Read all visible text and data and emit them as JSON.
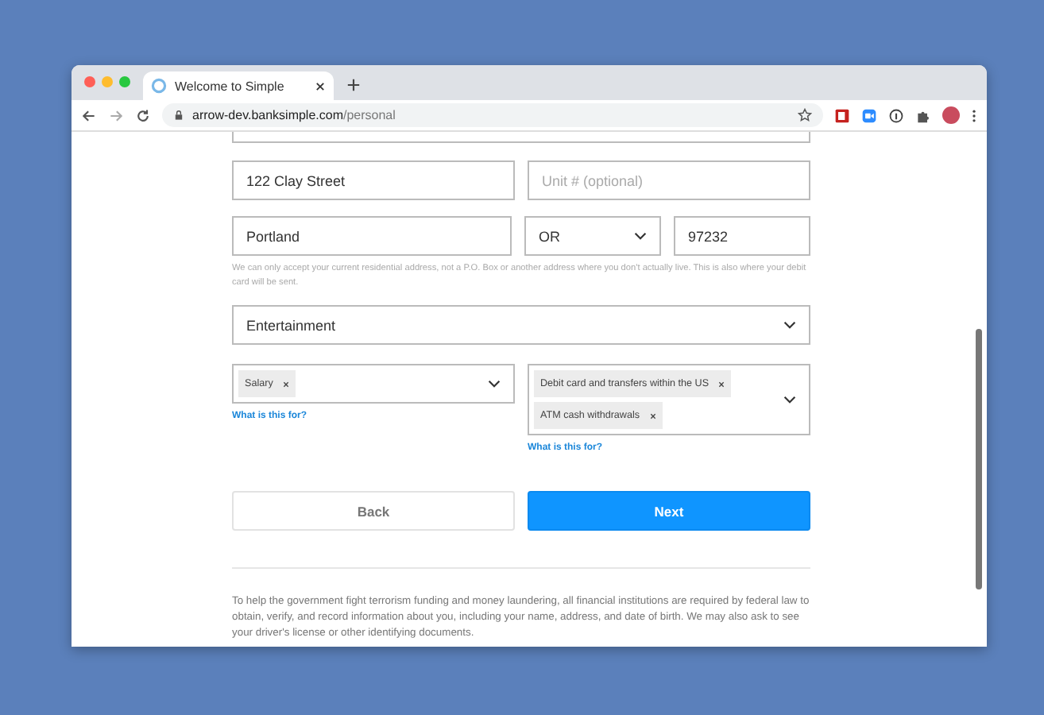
{
  "browser": {
    "tab": {
      "title": "Welcome to Simple"
    },
    "url": {
      "host": "arrow-dev.banksimple.com",
      "path": "/personal"
    }
  },
  "form": {
    "address": {
      "street": {
        "value": "122 Clay Street"
      },
      "unit": {
        "placeholder": "Unit # (optional)"
      },
      "city": {
        "value": "Portland"
      },
      "state": {
        "value": "OR"
      },
      "zip": {
        "value": "97232"
      },
      "note": "We can only accept your current residential address, not a P.O. Box or another address where you don't actually live. This is also where your debit card will be sent."
    },
    "occupation": {
      "value": "Entertainment"
    },
    "income_source": {
      "tags": [
        "Salary"
      ],
      "help_link": "What is this for?"
    },
    "account_use": {
      "tags": [
        "Debit card and transfers within the US",
        "ATM cash withdrawals"
      ],
      "help_link": "What is this for?"
    },
    "buttons": [
      {
        "label": "Back",
        "kind": "secondary"
      },
      {
        "label": "Next",
        "kind": "primary"
      }
    ],
    "disclaimer": "To help the government fight terrorism funding and money laundering, all financial institutions are required by federal law to obtain, verify, and record information about you, including your name, address, and date of birth. We may also ask to see your driver's license or other identifying documents."
  }
}
